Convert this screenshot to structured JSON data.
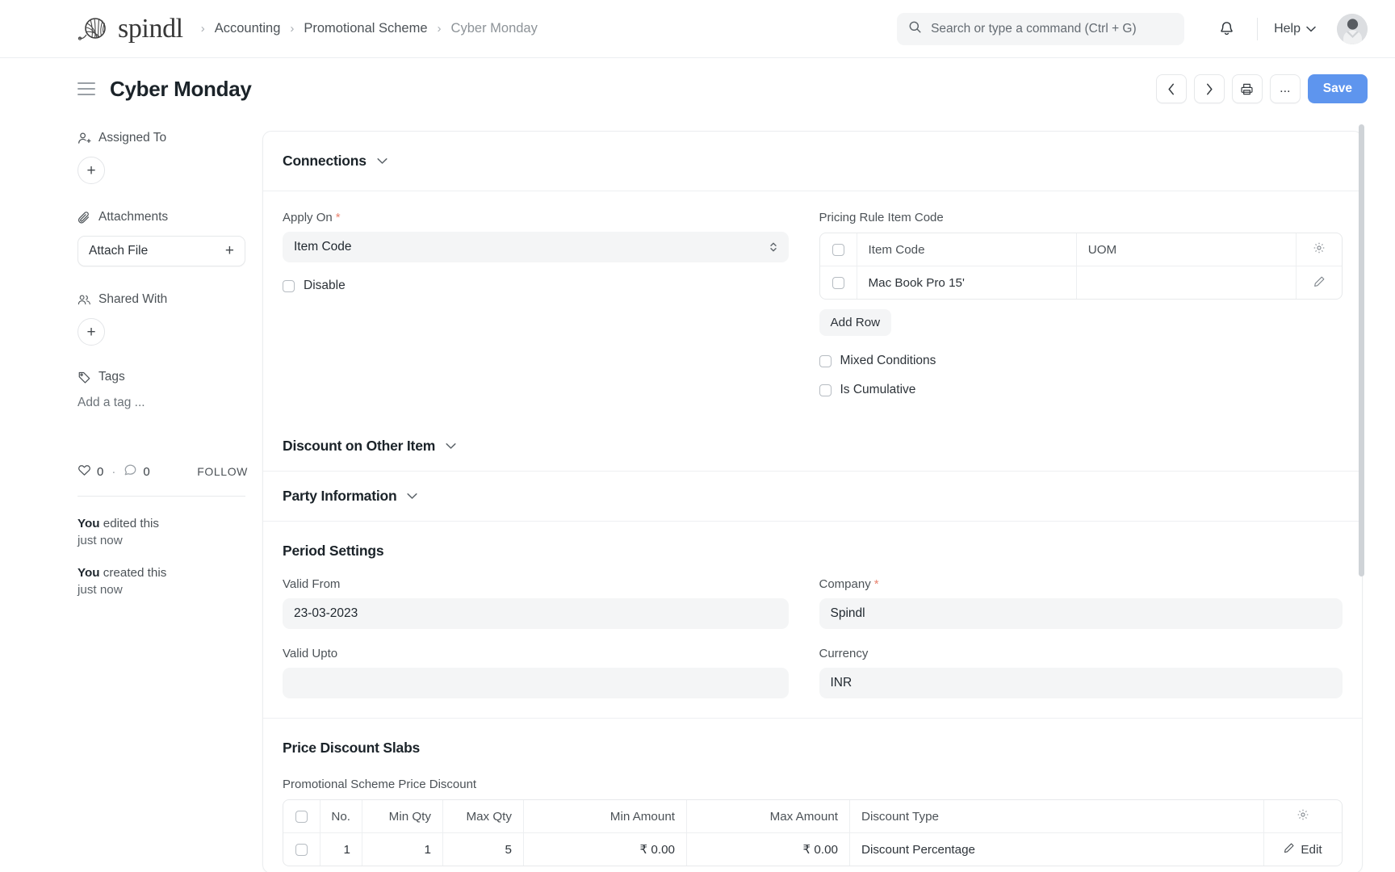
{
  "navbar": {
    "brand": "spindl",
    "breadcrumbs": [
      {
        "label": "Accounting",
        "current": false
      },
      {
        "label": "Promotional Scheme",
        "current": false
      },
      {
        "label": "Cyber Monday",
        "current": true
      }
    ],
    "search_placeholder": "Search or type a command (Ctrl + G)",
    "search_value": "",
    "help_label": "Help",
    "icons": {
      "search": "search-icon",
      "bell": "notification-bell-icon",
      "chevron": "chevron-down-icon",
      "avatar": "user-avatar"
    }
  },
  "page": {
    "title": "Cyber Monday",
    "actions": {
      "prev": "‹",
      "next": "›",
      "print": "print-icon",
      "more": "...",
      "save": "Save"
    }
  },
  "sidebar": {
    "assigned_to": {
      "label": "Assigned To",
      "add": "+"
    },
    "attachments": {
      "label": "Attachments",
      "button": "Attach File",
      "add": "+"
    },
    "shared_with": {
      "label": "Shared With",
      "add": "+"
    },
    "tags": {
      "label": "Tags",
      "placeholder": "Add a tag ..."
    },
    "social": {
      "likes": "0",
      "comments": "0",
      "separator": "·",
      "follow": "FOLLOW"
    },
    "activity": [
      {
        "who": "You",
        "what": " edited this",
        "when": "just now"
      },
      {
        "who": "You",
        "what": " created this",
        "when": "just now"
      }
    ]
  },
  "connections": {
    "title": "Connections",
    "apply_on": {
      "label": "Apply On",
      "required": "*",
      "value": "Item Code"
    },
    "disable": {
      "label": "Disable",
      "checked": false
    },
    "pricing_rule_item_code": {
      "label": "Pricing Rule Item Code",
      "columns": [
        "Item Code",
        "UOM"
      ],
      "rows": [
        {
          "item_code": "Mac Book Pro 15'",
          "uom": ""
        }
      ],
      "add_row": "Add Row",
      "settings_icon": "gear-icon",
      "edit_icon": "pencil-icon"
    },
    "mixed_conditions": {
      "label": "Mixed Conditions",
      "checked": false
    },
    "is_cumulative": {
      "label": "Is Cumulative",
      "checked": false
    }
  },
  "discount_on_other_item": {
    "title": "Discount on Other Item"
  },
  "party_information": {
    "title": "Party Information"
  },
  "period_settings": {
    "title": "Period Settings",
    "valid_from": {
      "label": "Valid From",
      "value": "23-03-2023"
    },
    "valid_upto": {
      "label": "Valid Upto",
      "value": ""
    },
    "company": {
      "label": "Company",
      "required": "*",
      "value": "Spindl"
    },
    "currency": {
      "label": "Currency",
      "value": "INR"
    }
  },
  "price_discount_slabs": {
    "title": "Price Discount Slabs",
    "table_label": "Promotional Scheme Price Discount",
    "columns": [
      "No.",
      "Min Qty",
      "Max Qty",
      "Min Amount",
      "Max Amount",
      "Discount Type"
    ],
    "rows": [
      {
        "no": "1",
        "min_qty": "1",
        "max_qty": "5",
        "min_amount": "₹ 0.00",
        "max_amount": "₹ 0.00",
        "discount_type": "Discount Percentage",
        "edit": "Edit"
      }
    ],
    "settings_icon": "gear-icon",
    "edit_icon": "pencil-icon"
  },
  "colors": {
    "accent": "#5e95ee",
    "required": "#e8836f",
    "input_bg": "#f4f5f6",
    "border": "#ebedef"
  }
}
